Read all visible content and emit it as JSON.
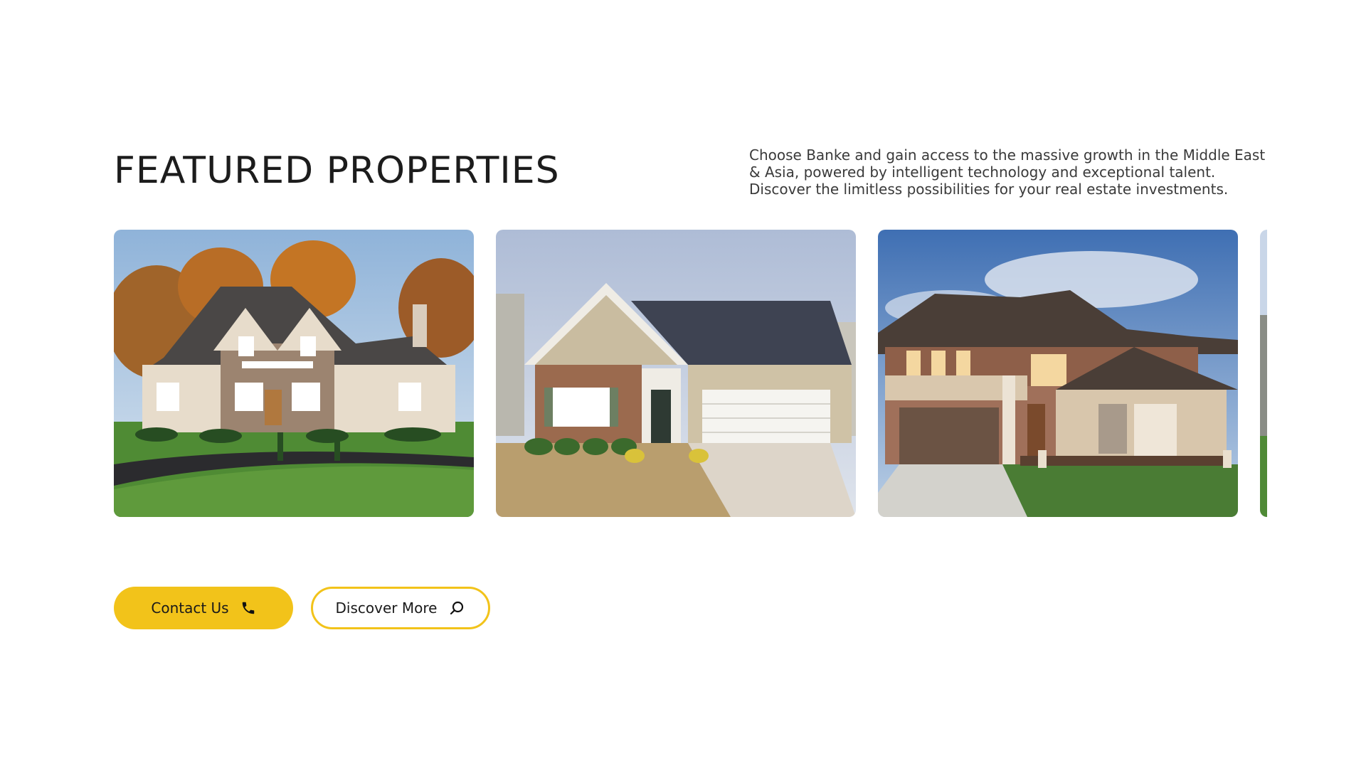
{
  "section": {
    "title": "FEATURED PROPERTIES",
    "intro": "Choose Banke and gain access to the massive growth in the Middle East & Asia, powered by intelligent technology and exceptional talent. Discover the limitless possibilities for your real estate investments."
  },
  "properties": [
    {
      "image": "stone-manor-house-photo"
    },
    {
      "image": "ranch-house-with-garage-photo"
    },
    {
      "image": "modern-prairie-house-photo"
    },
    {
      "image": "partial-house-photo"
    }
  ],
  "actions": {
    "contact_label": "Contact Us",
    "contact_icon": "phone-icon",
    "discover_label": "Discover More",
    "discover_icon": "search-icon"
  },
  "colors": {
    "accent": "#f2c31a",
    "text": "#1c1c1c",
    "background": "#ffffff"
  }
}
